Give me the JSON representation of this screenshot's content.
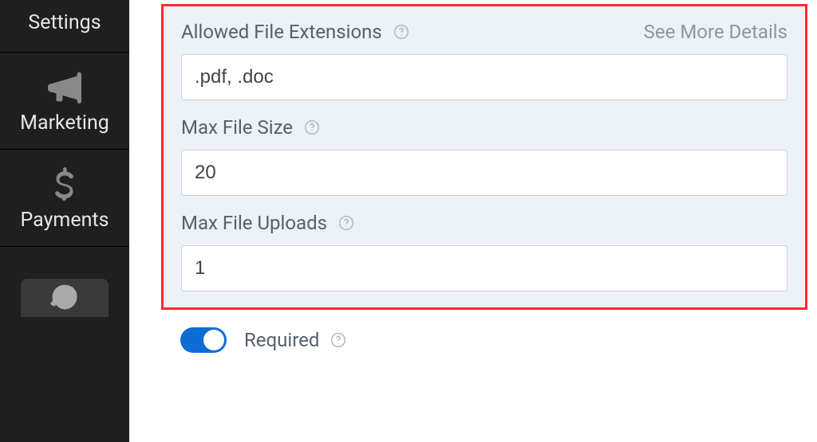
{
  "sidebar": {
    "items": [
      {
        "label": "Settings"
      },
      {
        "label": "Marketing"
      },
      {
        "label": "Payments"
      }
    ]
  },
  "panel": {
    "allowed_ext": {
      "label": "Allowed File Extensions",
      "value": ".pdf, .doc",
      "more": "See More Details"
    },
    "max_size": {
      "label": "Max File Size",
      "value": "20"
    },
    "max_uploads": {
      "label": "Max File Uploads",
      "value": "1"
    }
  },
  "required": {
    "label": "Required",
    "on": true
  }
}
